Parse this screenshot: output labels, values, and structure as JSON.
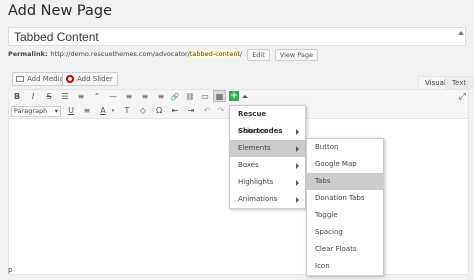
{
  "header": {
    "title": "Add New Page"
  },
  "title_field": {
    "value": "Tabbed Content"
  },
  "permalink": {
    "label": "Permalink:",
    "url_base": "http://demo.rescuethemes.com/advocator/",
    "slug": "tabbed-content",
    "url_end": "/",
    "edit_label": "Edit",
    "view_label": "View Page"
  },
  "media_buttons": {
    "add_media": "Add Media",
    "add_slider": "Add Slider"
  },
  "editor_tabs": {
    "visual": "Visual",
    "text": "Text"
  },
  "toolbar": {
    "row1": [
      {
        "name": "bold-icon",
        "glyph": "B"
      },
      {
        "name": "italic-icon",
        "glyph": "I"
      },
      {
        "name": "strikethrough-icon",
        "glyph": "S"
      },
      {
        "name": "bullet-list-icon",
        "glyph": "☰"
      },
      {
        "name": "numbered-list-icon",
        "glyph": "≡"
      },
      {
        "name": "blockquote-icon",
        "glyph": "“"
      },
      {
        "name": "horizontal-rule-icon",
        "glyph": "—"
      },
      {
        "name": "align-left-icon",
        "glyph": "≡"
      },
      {
        "name": "align-center-icon",
        "glyph": "≡"
      },
      {
        "name": "align-right-icon",
        "glyph": "≡"
      },
      {
        "name": "insert-link-icon",
        "glyph": "🔗"
      },
      {
        "name": "remove-link-icon",
        "glyph": "⛓"
      },
      {
        "name": "read-more-icon",
        "glyph": "▭"
      },
      {
        "name": "toolbar-toggle-icon",
        "glyph": "▦"
      }
    ],
    "format_select": "Paragraph",
    "row2": [
      {
        "name": "underline-icon",
        "glyph": "U"
      },
      {
        "name": "justify-icon",
        "glyph": "≡"
      },
      {
        "name": "text-color-icon",
        "glyph": "A"
      },
      {
        "name": "paste-text-icon",
        "glyph": "T"
      },
      {
        "name": "clear-formatting-icon",
        "glyph": "◇"
      },
      {
        "name": "special-character-icon",
        "glyph": "Ω"
      },
      {
        "name": "outdent-icon",
        "glyph": "⇤"
      },
      {
        "name": "indent-icon",
        "glyph": "⇥"
      },
      {
        "name": "undo-icon",
        "glyph": "↶"
      },
      {
        "name": "redo-icon",
        "glyph": "↷"
      },
      {
        "name": "help-icon",
        "glyph": "?"
      }
    ]
  },
  "shortcodes_menu": {
    "header": "Rescue Shortcodes",
    "items": [
      "Columns",
      "Elements",
      "Boxes",
      "Highlights",
      "Animations"
    ]
  },
  "elements_submenu": {
    "items": [
      "Button",
      "Google Map",
      "Tabs",
      "Donation Tabs",
      "Toggle",
      "Spacing",
      "Clear Floats",
      "Icon"
    ]
  },
  "status": {
    "path": "p"
  },
  "colors": {
    "selected": "#cccccc",
    "plus": "#2bb24c",
    "slug_bg": "#fffbcc"
  }
}
